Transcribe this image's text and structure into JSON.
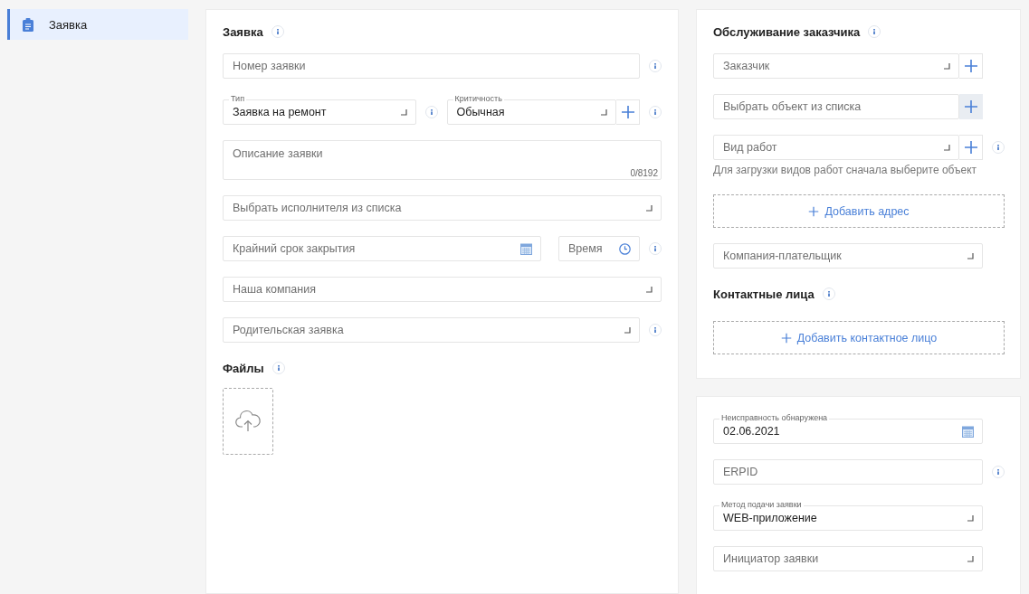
{
  "sidebar": {
    "items": [
      {
        "label": "Заявка",
        "selected": true
      }
    ]
  },
  "cards": [
    {
      "items": [
        {
          "kind": "heading",
          "text": "Заявка",
          "info": true
        },
        {
          "kind": "row",
          "fields": [
            {
              "kind": "text",
              "placeholder": "Номер заявки",
              "info": true
            }
          ]
        },
        {
          "kind": "row",
          "fields": [
            {
              "kind": "select",
              "label": "Тип",
              "value": "Заявка на ремонт",
              "info": true
            },
            {
              "kind": "select",
              "label": "Критичность",
              "value": "Обычная",
              "add_button": true,
              "add_highlighted": false,
              "info": true
            }
          ]
        },
        {
          "kind": "row",
          "fields": [
            {
              "kind": "textarea",
              "placeholder": "Описание заявки",
              "counter": "0/8192"
            }
          ]
        },
        {
          "kind": "row",
          "fields": [
            {
              "kind": "select",
              "placeholder": "Выбрать исполнителя из списка"
            }
          ]
        },
        {
          "kind": "row",
          "fields": [
            {
              "kind": "date",
              "placeholder": "Крайний срок закрытия"
            },
            {
              "kind": "time",
              "placeholder": "Время",
              "info": true
            }
          ]
        },
        {
          "kind": "row",
          "fields": [
            {
              "kind": "select",
              "placeholder": "Наша компания"
            }
          ]
        },
        {
          "kind": "row",
          "fields": [
            {
              "kind": "select",
              "placeholder": "Родительская заявка",
              "info": true
            }
          ]
        },
        {
          "kind": "heading",
          "text": "Файлы",
          "info": true
        },
        {
          "kind": "upload"
        }
      ]
    },
    {
      "items": [
        {
          "kind": "heading",
          "text": "Обслуживание заказчика",
          "info": true
        },
        {
          "kind": "row",
          "fields": [
            {
              "kind": "select",
              "placeholder": "Заказчик",
              "add_button": true,
              "add_highlighted": false
            }
          ]
        },
        {
          "kind": "row",
          "fields": [
            {
              "kind": "text",
              "placeholder": "Выбрать объект из списка",
              "add_button": true,
              "add_highlighted": true
            }
          ]
        },
        {
          "kind": "row",
          "fields": [
            {
              "kind": "select",
              "placeholder": "Вид работ",
              "add_button": true,
              "add_highlighted": false,
              "info": true
            }
          ]
        },
        {
          "kind": "hint",
          "text": "Для загрузки видов работ сначала выберите объект"
        },
        {
          "kind": "dashed_button",
          "text": "Добавить адрес"
        },
        {
          "kind": "row",
          "fields": [
            {
              "kind": "select",
              "placeholder": "Компания-плательщик"
            }
          ]
        },
        {
          "kind": "heading",
          "text": "Контактные лица",
          "info": true
        },
        {
          "kind": "dashed_button",
          "text": "Добавить контактное лицо"
        }
      ]
    },
    {
      "items": [
        {
          "kind": "row",
          "fields": [
            {
              "kind": "date",
              "label": "Неисправность обнаружена",
              "value": "02.06.2021"
            }
          ]
        },
        {
          "kind": "row",
          "fields": [
            {
              "kind": "text",
              "placeholder": "ERPID",
              "info": true
            }
          ]
        },
        {
          "kind": "row",
          "fields": [
            {
              "kind": "select",
              "label": "Метод подачи заявки",
              "value": "WEB-приложение"
            }
          ]
        },
        {
          "kind": "row",
          "fields": [
            {
              "kind": "select",
              "placeholder": "Инициатор заявки"
            }
          ]
        }
      ]
    }
  ]
}
